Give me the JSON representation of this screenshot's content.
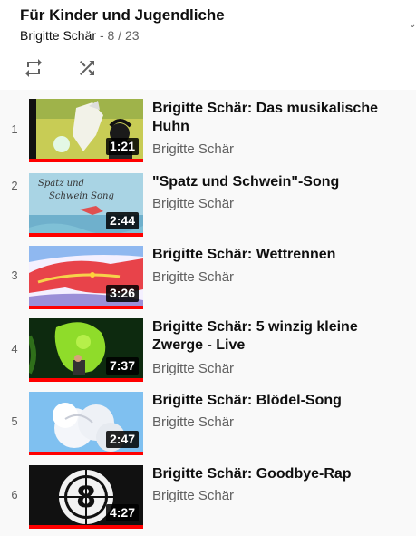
{
  "playlist": {
    "title": "Für Kinder und Jugendliche",
    "owner": "Brigitte Schär",
    "position": "- 8 / 23"
  },
  "controls": {
    "loop_icon": "loop-icon",
    "shuffle_icon": "shuffle-icon"
  },
  "videos": [
    {
      "index": "1",
      "title": "Brigitte Schär: Das musikalische Huhn",
      "channel": "Brigitte Schär",
      "duration": "1:21",
      "progress": 1.0
    },
    {
      "index": "2",
      "title": "\"Spatz und Schwein\"-Song",
      "channel": "Brigitte Schär",
      "duration": "2:44",
      "progress": 1.0,
      "thumb_text_1": "Spatz und",
      "thumb_text_2": "Schwein Song"
    },
    {
      "index": "3",
      "title": "Brigitte Schär: Wettrennen",
      "channel": "Brigitte Schär",
      "duration": "3:26",
      "progress": 1.0
    },
    {
      "index": "4",
      "title": "Brigitte Schär: 5 winzig kleine Zwerge - Live",
      "channel": "Brigitte Schär",
      "duration": "7:37",
      "progress": 1.0
    },
    {
      "index": "5",
      "title": "Brigitte Schär: Blödel-Song",
      "channel": "Brigitte Schär",
      "duration": "2:47",
      "progress": 1.0
    },
    {
      "index": "6",
      "title": "Brigitte Schär: Goodbye-Rap",
      "channel": "Brigitte Schär",
      "duration": "4:27",
      "progress": 1.0,
      "thumb_text_1": "8"
    }
  ],
  "colors": {
    "progress_bar": "#ff0000",
    "list_background": "#f9f9f9",
    "secondary_text": "#606060"
  }
}
